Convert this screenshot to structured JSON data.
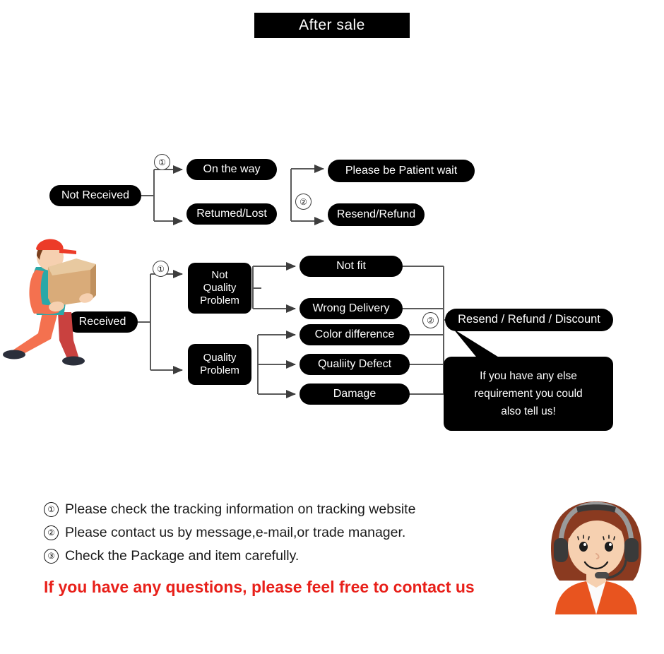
{
  "header": {
    "title": "After sale"
  },
  "flow": {
    "not_received": {
      "label": "Not Received",
      "step_marker": "①",
      "branches": [
        {
          "label": "On the way",
          "result": "Please be Patient wait"
        },
        {
          "label": "Retumed/Lost",
          "result": "Resend/Refund"
        }
      ],
      "result_step_marker": "②"
    },
    "received": {
      "label": "Received",
      "step_marker": "①",
      "categories": [
        {
          "label": "Not\nQuality\nProblem",
          "label_lines": [
            "Not",
            "Quality",
            "Problem"
          ],
          "issues": [
            "Not fit",
            "Wrong Delivery"
          ]
        },
        {
          "label": "Quality\nProblem",
          "label_lines": [
            "Quality",
            "Problem"
          ],
          "issues": [
            "Color difference",
            "Qualiity Defect",
            "Damage"
          ]
        }
      ],
      "result_step_marker": "②",
      "result": "Resend / Refund / Discount"
    },
    "callout": {
      "lines": [
        "If you have any else",
        "requirement you could",
        "also tell us!"
      ],
      "text": "If you have any else requirement you could also tell us!"
    }
  },
  "notes": [
    {
      "marker": "①",
      "text": "Please check the tracking information on tracking website"
    },
    {
      "marker": "②",
      "text": "Please contact us by message,e-mail,or trade manager."
    },
    {
      "marker": "③",
      "text": "Check the Package and item carefully."
    }
  ],
  "cta": {
    "text": "If you have any questions, please feel free to contact us"
  },
  "illustrations": {
    "courier": "delivery-man-carrying-box",
    "agent": "customer-service-agent-headset"
  },
  "colors": {
    "node_bg": "#000000",
    "node_text": "#ffffff",
    "page_bg": "#ffffff",
    "wire": "#5a5a5a",
    "cta_red": "#e8201a",
    "courier_shirt": "#2aa8a8",
    "courier_sleeve": "#f4714f",
    "courier_cap": "#ec3b28",
    "courier_pants_left": "#f4714f",
    "courier_pants_right": "#c9413f",
    "box_front": "#d9ab79",
    "box_top": "#e8c9a0",
    "box_side": "#c0915f",
    "skin": "#f6d0b0",
    "hair": "#7b3f1d",
    "agent_hair": "#8a3a20",
    "agent_shirt": "#e8541f",
    "agent_headset": "#3a3a3a"
  }
}
